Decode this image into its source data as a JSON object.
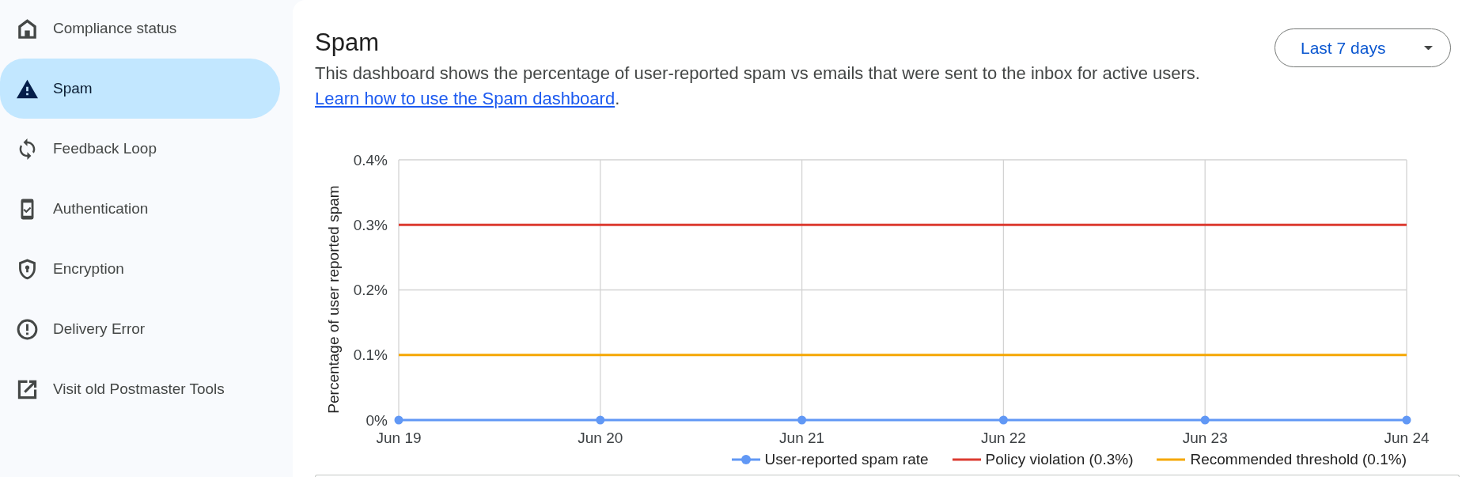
{
  "sidebar": {
    "items": [
      {
        "label": "Compliance status",
        "selected": false
      },
      {
        "label": "Spam",
        "selected": true
      },
      {
        "label": "Feedback Loop",
        "selected": false
      },
      {
        "label": "Authentication",
        "selected": false
      },
      {
        "label": "Encryption",
        "selected": false
      },
      {
        "label": "Delivery Error",
        "selected": false
      },
      {
        "label": "Visit old Postmaster Tools",
        "selected": false
      }
    ]
  },
  "header": {
    "title": "Spam",
    "description": {
      "text": "This dashboard shows the percentage of user-reported spam vs emails that were sent to the inbox for active users.",
      "link": "Learn how to use the Spam dashboard",
      "end": "."
    }
  },
  "date_range": {
    "value": "Last 7 days"
  },
  "chart": {
    "chart_data": {
      "type": "line",
      "ylabel": "Percentage of user reported spam",
      "categories": [
        "Jun 19",
        "Jun 20",
        "Jun 21",
        "Jun 22",
        "Jun 23",
        "Jun 24"
      ],
      "ylim": [
        0,
        0.4
      ],
      "yticks": [
        {
          "value": 0,
          "label": "0%"
        },
        {
          "value": 0.1,
          "label": "0.1%"
        },
        {
          "value": 0.2,
          "label": "0.2%"
        },
        {
          "value": 0.3,
          "label": "0.3%"
        },
        {
          "value": 0.4,
          "label": "0.4%"
        }
      ],
      "grid": true,
      "legend": "bottom",
      "series": [
        {
          "name": "User-reported spam rate",
          "color": "#6198f5",
          "marker": "circle",
          "values": [
            0,
            0,
            0,
            0,
            0,
            0
          ]
        },
        {
          "name": "Policy violation (0.3%)",
          "color": "#dc3b30",
          "values": [
            0.3,
            0.3,
            0.3,
            0.3,
            0.3,
            0.3
          ]
        },
        {
          "name": "Recommended threshold (0.1%)",
          "color": "#f5a700",
          "values": [
            0.1,
            0.1,
            0.1,
            0.1,
            0.1,
            0.1
          ]
        }
      ]
    }
  }
}
